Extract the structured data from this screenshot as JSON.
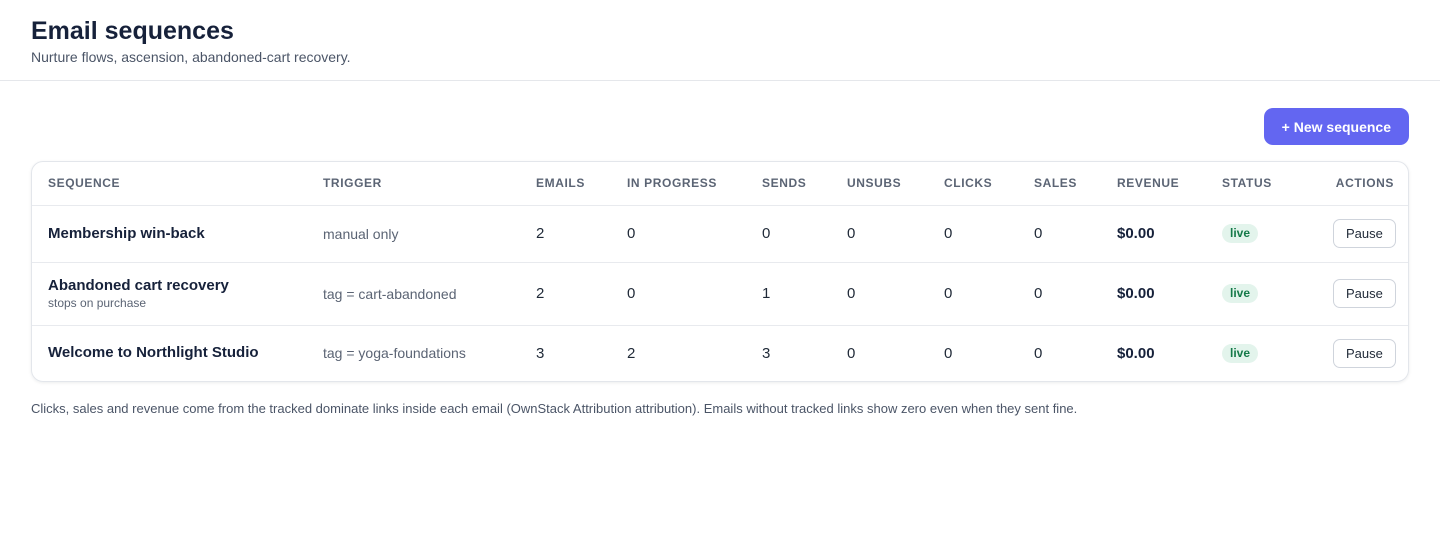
{
  "header": {
    "title": "Email sequences",
    "subtitle": "Nurture flows, ascension, abandoned-cart recovery."
  },
  "toolbar": {
    "new_sequence_label": "+ New sequence"
  },
  "table": {
    "columns": [
      "SEQUENCE",
      "TRIGGER",
      "EMAILS",
      "IN PROGRESS",
      "SENDS",
      "UNSUBS",
      "CLICKS",
      "SALES",
      "REVENUE",
      "STATUS",
      "ACTIONS"
    ],
    "rows": [
      {
        "name": "Membership win-back",
        "note": "",
        "trigger": "manual only",
        "emails": "2",
        "in_progress": "0",
        "sends": "0",
        "unsubs": "0",
        "clicks": "0",
        "sales": "0",
        "revenue": "$0.00",
        "status": "live",
        "action": "Pause"
      },
      {
        "name": "Abandoned cart recovery",
        "note": "stops on purchase",
        "trigger": "tag = cart-abandoned",
        "emails": "2",
        "in_progress": "0",
        "sends": "1",
        "unsubs": "0",
        "clicks": "0",
        "sales": "0",
        "revenue": "$0.00",
        "status": "live",
        "action": "Pause"
      },
      {
        "name": "Welcome to Northlight Studio",
        "note": "",
        "trigger": "tag = yoga-foundations",
        "emails": "3",
        "in_progress": "2",
        "sends": "3",
        "unsubs": "0",
        "clicks": "0",
        "sales": "0",
        "revenue": "$0.00",
        "status": "live",
        "action": "Pause"
      }
    ]
  },
  "footnote": "Clicks, sales and revenue come from the tracked dominate links inside each email (OwnStack Attribution attribution). Emails without tracked links show zero even when they sent fine.",
  "colors": {
    "accent": "#6366f1",
    "live_badge_bg": "#e3f4ec",
    "live_badge_text": "#157a49"
  }
}
